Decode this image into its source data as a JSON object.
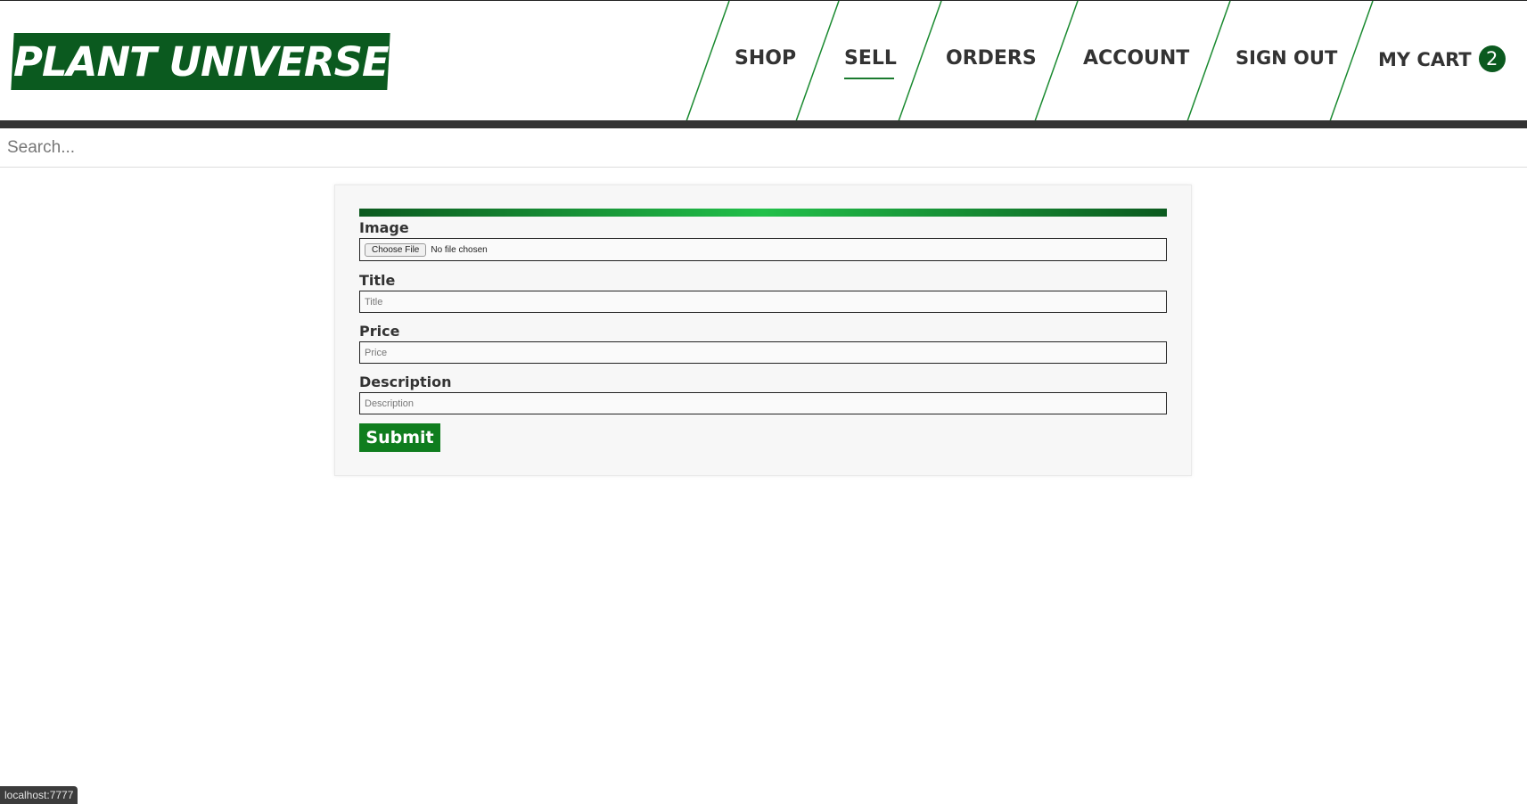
{
  "brand": {
    "logo_text": "PLANT UNIVERSE",
    "color": "#0b5a1f"
  },
  "nav": {
    "items": [
      {
        "label": "SHOP",
        "active": false
      },
      {
        "label": "SELL",
        "active": true
      },
      {
        "label": "ORDERS",
        "active": false
      },
      {
        "label": "ACCOUNT",
        "active": false
      },
      {
        "label": "SIGN OUT",
        "active": false
      }
    ],
    "cart": {
      "label": "MY CART",
      "count": "2"
    }
  },
  "search": {
    "placeholder": "Search..."
  },
  "form": {
    "image": {
      "label": "Image",
      "button_label": "Choose File",
      "status": "No file chosen"
    },
    "title": {
      "label": "Title",
      "placeholder": "Title"
    },
    "price": {
      "label": "Price",
      "placeholder": "Price"
    },
    "description": {
      "label": "Description",
      "placeholder": "Description"
    },
    "submit_label": "Submit"
  },
  "status_bar": {
    "url": "localhost:7777"
  },
  "colors": {
    "accent": "#0f7d1e",
    "gradient_mid": "#22c04a",
    "dark_bar": "#333333"
  }
}
